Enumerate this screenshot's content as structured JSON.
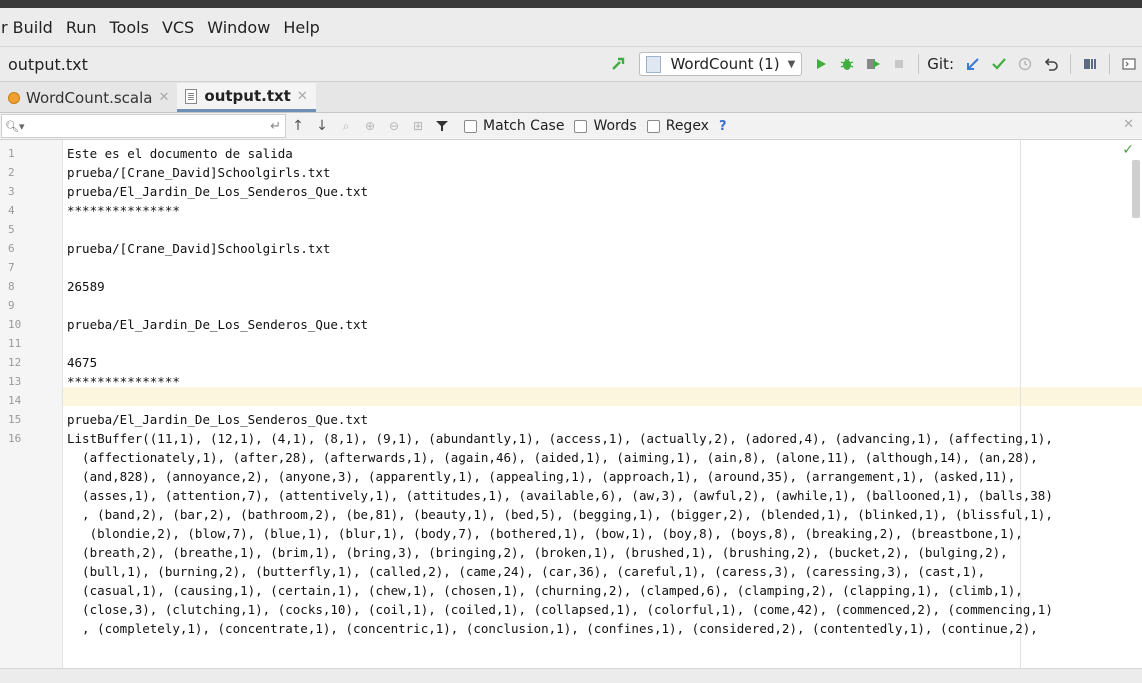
{
  "menu": [
    "r Build",
    "Run",
    "Tools",
    "VCS",
    "Window",
    "Help"
  ],
  "nav": {
    "breadcrumb": "output.txt",
    "run_config": "WordCount (1)",
    "git_label": "Git:"
  },
  "tabs": [
    {
      "label": "WordCount.scala",
      "icon": "scala-file-icon"
    },
    {
      "label": "output.txt",
      "icon": "text-file-icon"
    }
  ],
  "search": {
    "placeholder": "",
    "match_case": "Match Case",
    "words": "Words",
    "regex": "Regex",
    "help": "?"
  },
  "editor": {
    "line_numbers": [
      "1",
      "2",
      "3",
      "4",
      "5",
      "6",
      "7",
      "8",
      "9",
      "10",
      "11",
      "12",
      "13",
      "14",
      "15",
      "16"
    ],
    "lines": [
      "Este es el documento de salida",
      "prueba/[Crane_David]Schoolgirls.txt",
      "prueba/El_Jardin_De_Los_Senderos_Que.txt",
      "***************",
      "",
      "prueba/[Crane_David]Schoolgirls.txt",
      "",
      "26589",
      "",
      "prueba/El_Jardin_De_Los_Senderos_Que.txt",
      "",
      "4675",
      "***************",
      "",
      "prueba/El_Jardin_De_Los_Senderos_Que.txt",
      "ListBuffer((11,1), (12,1), (4,1), (8,1), (9,1), (abundantly,1), (access,1), (actually,2), (adored,4), (advancing,1), (affecting,1),",
      "  (affectionately,1), (after,28), (afterwards,1), (again,46), (aided,1), (aiming,1), (ain,8), (alone,11), (although,14), (an,28),",
      "  (and,828), (annoyance,2), (anyone,3), (apparently,1), (appealing,1), (approach,1), (around,35), (arrangement,1), (asked,11),",
      "  (asses,1), (attention,7), (attentively,1), (attitudes,1), (available,6), (aw,3), (awful,2), (awhile,1), (ballooned,1), (balls,38)",
      "  , (band,2), (bar,2), (bathroom,2), (be,81), (beauty,1), (bed,5), (begging,1), (bigger,2), (blended,1), (blinked,1), (blissful,1),",
      "   (blondie,2), (blow,7), (blue,1), (blur,1), (body,7), (bothered,1), (bow,1), (boy,8), (boys,8), (breaking,2), (breastbone,1),",
      "  (breath,2), (breathe,1), (brim,1), (bring,3), (bringing,2), (broken,1), (brushed,1), (brushing,2), (bucket,2), (bulging,2),",
      "  (bull,1), (burning,2), (butterfly,1), (called,2), (came,24), (car,36), (careful,1), (caress,3), (caressing,3), (cast,1),",
      "  (casual,1), (causing,1), (certain,1), (chew,1), (chosen,1), (churning,2), (clamped,6), (clamping,2), (clapping,1), (climb,1),",
      "  (close,3), (clutching,1), (cocks,10), (coil,1), (coiled,1), (collapsed,1), (colorful,1), (come,42), (commenced,2), (commencing,1)",
      "  , (completely,1), (concentrate,1), (concentric,1), (conclusion,1), (confines,1), (considered,2), (contentedly,1), (continue,2),"
    ]
  },
  "colors": {
    "accent": "#6f8fb5",
    "run_green": "#3fae3f",
    "git_blue": "#3d7ad6",
    "caret_row": "#fcf6df"
  }
}
